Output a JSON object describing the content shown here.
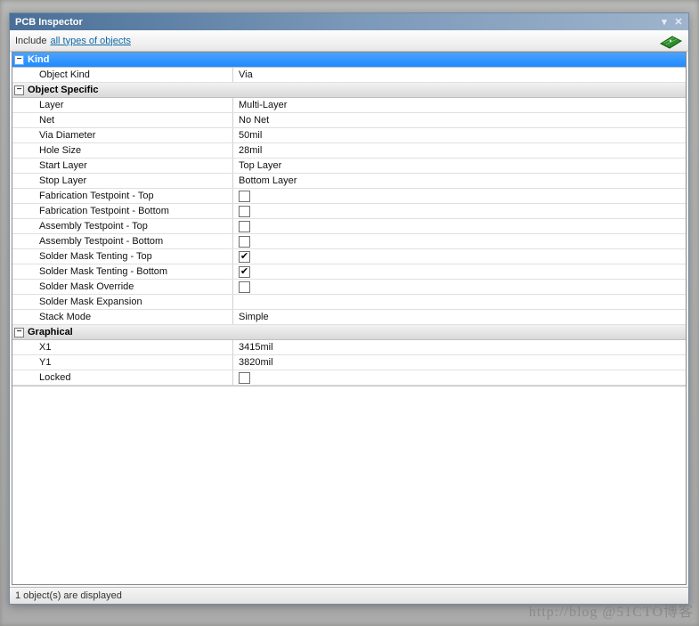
{
  "title": "PCB Inspector",
  "include": {
    "label": "Include",
    "link": "all types of objects"
  },
  "sections": {
    "kind": {
      "header": "Kind",
      "rows": [
        {
          "label": "Object Kind",
          "value": "Via",
          "type": "text"
        }
      ]
    },
    "objspec": {
      "header": "Object Specific",
      "rows": [
        {
          "label": "Layer",
          "value": "Multi-Layer",
          "type": "text"
        },
        {
          "label": "Net",
          "value": "No Net",
          "type": "text"
        },
        {
          "label": "Via Diameter",
          "value": "50mil",
          "type": "text"
        },
        {
          "label": "Hole Size",
          "value": "28mil",
          "type": "text"
        },
        {
          "label": "Start Layer",
          "value": "Top Layer",
          "type": "text"
        },
        {
          "label": "Stop Layer",
          "value": "Bottom Layer",
          "type": "text"
        },
        {
          "label": "Fabrication Testpoint - Top",
          "value": false,
          "type": "check"
        },
        {
          "label": "Fabrication Testpoint - Bottom",
          "value": false,
          "type": "check"
        },
        {
          "label": "Assembly Testpoint - Top",
          "value": false,
          "type": "check"
        },
        {
          "label": "Assembly Testpoint - Bottom",
          "value": false,
          "type": "check"
        },
        {
          "label": "Solder Mask Tenting - Top",
          "value": true,
          "type": "check"
        },
        {
          "label": "Solder Mask Tenting - Bottom",
          "value": true,
          "type": "check"
        },
        {
          "label": "Solder Mask Override",
          "value": false,
          "type": "check"
        },
        {
          "label": "Solder Mask Expansion",
          "value": "",
          "type": "text"
        },
        {
          "label": "Stack Mode",
          "value": "Simple",
          "type": "text"
        }
      ]
    },
    "graphical": {
      "header": "Graphical",
      "rows": [
        {
          "label": "X1",
          "value": "3415mil",
          "type": "text"
        },
        {
          "label": "Y1",
          "value": "3820mil",
          "type": "text"
        },
        {
          "label": "Locked",
          "value": false,
          "type": "check"
        }
      ]
    }
  },
  "status": "1 object(s) are displayed",
  "expand_glyph": "−",
  "check_glyph": "✔",
  "watermark": "http://blog @51CTO博客"
}
